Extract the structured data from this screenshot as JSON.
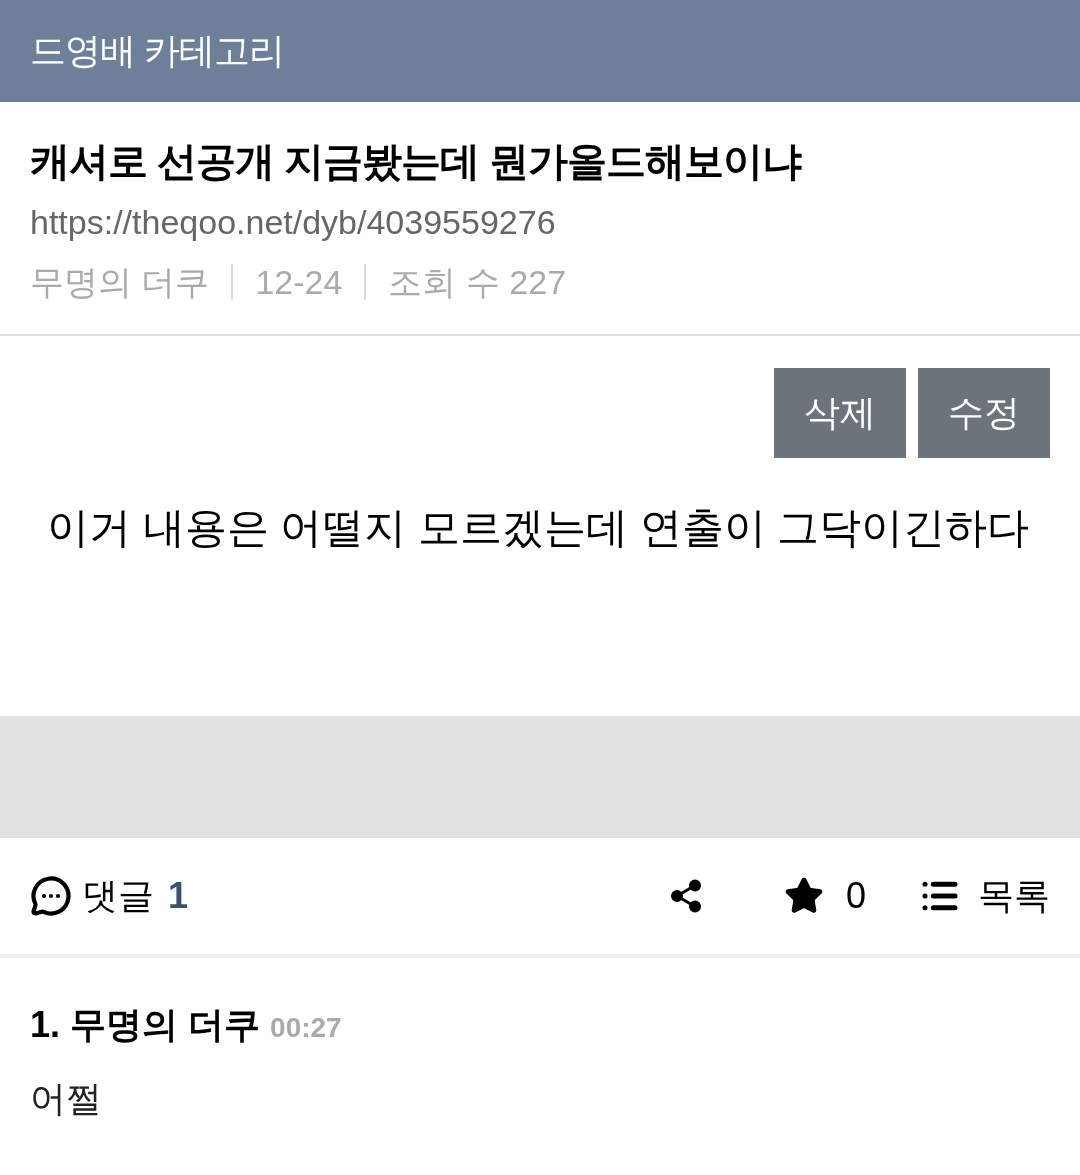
{
  "header": {
    "title": "드영배 카테고리"
  },
  "post": {
    "title": "캐셔로 선공개 지금봤는데 뭔가올드해보이냐",
    "url": "https://theqoo.net/dyb/4039559276",
    "meta": [
      "무명의 더쿠",
      "12-24",
      "조회 수 227"
    ],
    "actions": [
      {
        "label": "삭제"
      },
      {
        "label": "수정"
      }
    ],
    "body": "이거 내용은 어떨지 모르겠는데 연출이 그닥이긴하다"
  },
  "toolbar": {
    "comments_label": "댓글",
    "comments_count": "1",
    "stars_count": "0",
    "list_label": "목록"
  },
  "comments": [
    {
      "number": "1.",
      "author": "무명의 더쿠",
      "time": "00:27",
      "text": "어쩔"
    }
  ]
}
